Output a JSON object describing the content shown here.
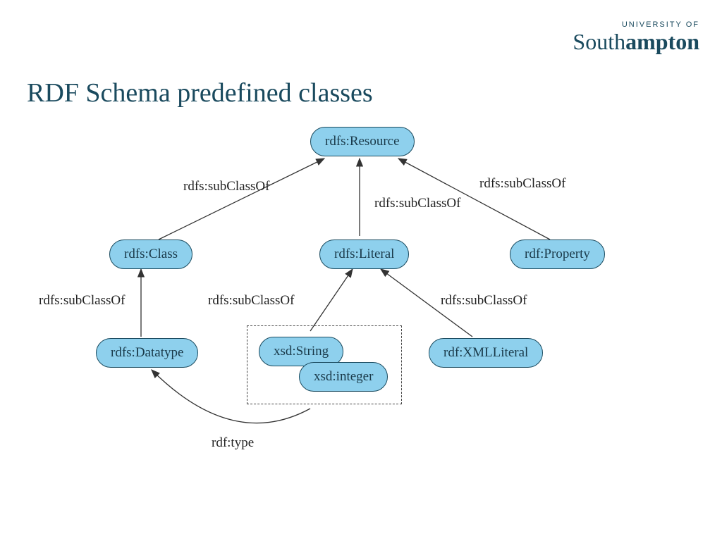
{
  "title": "RDF Schema predefined classes",
  "logo": {
    "sub": "UNIVERSITY OF",
    "south": "South",
    "ampton": "ampton"
  },
  "nodes": {
    "resource": "rdfs:Resource",
    "class": "rdfs:Class",
    "literal": "rdfs:Literal",
    "property": "rdf:Property",
    "datatype": "rdfs:Datatype",
    "xsdstring": "xsd:String",
    "xsdinteger": "xsd:integer",
    "xmlliteral": "rdf:XMLLiteral"
  },
  "labels": {
    "subClassOf1": "rdfs:subClassOf",
    "subClassOf2": "rdfs:subClassOf",
    "subClassOf3": "rdfs:subClassOf",
    "subClassOf4": "rdfs:subClassOf",
    "subClassOf5": "rdfs:subClassOf",
    "subClassOf6": "rdfs:subClassOf",
    "rdftype": "rdf:type"
  }
}
